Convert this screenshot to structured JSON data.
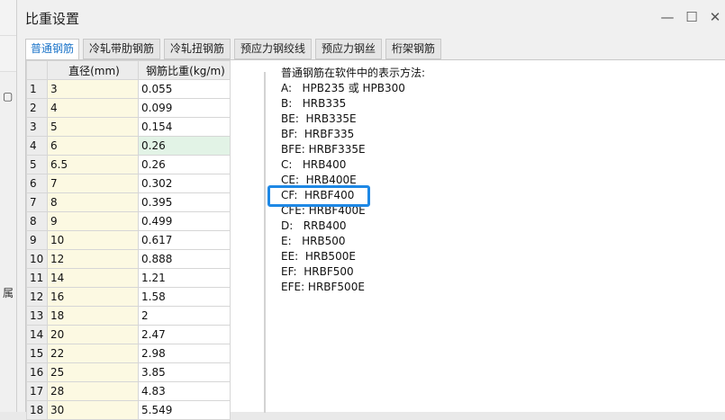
{
  "window": {
    "title": "比重设置"
  },
  "tabs": [
    {
      "label": "普通钢筋",
      "active": true
    },
    {
      "label": "冷轧带肋钢筋",
      "active": false
    },
    {
      "label": "冷轧扭钢筋",
      "active": false
    },
    {
      "label": "预应力钢绞线",
      "active": false
    },
    {
      "label": "预应力钢丝",
      "active": false
    },
    {
      "label": "桁架钢筋",
      "active": false
    }
  ],
  "table": {
    "headers": {
      "diameter": "直径(mm)",
      "weight": "钢筋比重(kg/m)"
    },
    "rows": [
      {
        "index": "1",
        "diameter": "3",
        "weight": "0.055"
      },
      {
        "index": "2",
        "diameter": "4",
        "weight": "0.099"
      },
      {
        "index": "3",
        "diameter": "5",
        "weight": "0.154"
      },
      {
        "index": "4",
        "diameter": "6",
        "weight": "0.26",
        "selected": true
      },
      {
        "index": "5",
        "diameter": "6.5",
        "weight": "0.26"
      },
      {
        "index": "6",
        "diameter": "7",
        "weight": "0.302"
      },
      {
        "index": "7",
        "diameter": "8",
        "weight": "0.395"
      },
      {
        "index": "8",
        "diameter": "9",
        "weight": "0.499"
      },
      {
        "index": "9",
        "diameter": "10",
        "weight": "0.617"
      },
      {
        "index": "10",
        "diameter": "12",
        "weight": "0.888"
      },
      {
        "index": "11",
        "diameter": "14",
        "weight": "1.21"
      },
      {
        "index": "12",
        "diameter": "16",
        "weight": "1.58"
      },
      {
        "index": "13",
        "diameter": "18",
        "weight": "2"
      },
      {
        "index": "14",
        "diameter": "20",
        "weight": "2.47"
      },
      {
        "index": "15",
        "diameter": "22",
        "weight": "2.98"
      },
      {
        "index": "16",
        "diameter": "25",
        "weight": "3.85"
      },
      {
        "index": "17",
        "diameter": "28",
        "weight": "4.83"
      },
      {
        "index": "18",
        "diameter": "30",
        "weight": "5.549"
      }
    ]
  },
  "description": {
    "title": "普通钢筋在软件中的表示方法:",
    "lines": [
      "A:   HPB235 或 HPB300",
      "B:   HRB335",
      "BE:  HRB335E",
      "BF:  HRBF335",
      "BFE: HRBF335E",
      "C:   HRB400",
      "CE:  HRB400E",
      "CF:  HRBF400",
      "CFE: HRBF400E",
      "D:   RRB400",
      "E:   HRB500",
      "EE:  HRB500E",
      "EF:  HRBF500",
      "EFE: HRBF500E"
    ],
    "highlighted_line": "CF:  HRBF400"
  },
  "colors": {
    "active_tab_text": "#1a73c8",
    "highlight_border": "#1e88e5",
    "diameter_cell_bg": "#fcf9e2",
    "selected_cell_bg": "#e2f3e6"
  },
  "icons": {
    "minimize": "minimize-icon",
    "maximize": "maximize-icon",
    "close": "close-icon"
  },
  "background": {
    "glyph_top": "▢",
    "glyph_mid": "属"
  }
}
